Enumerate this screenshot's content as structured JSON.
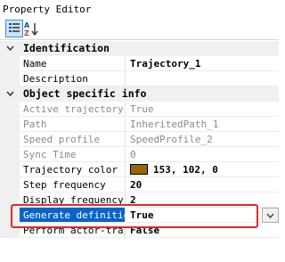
{
  "window": {
    "title": "Property Editor"
  },
  "toolbar": {
    "categorized": {
      "icon": "categorized-view-icon"
    },
    "alphabetical": {
      "icon": "sort-az-icon"
    }
  },
  "sections": [
    {
      "label": "Identification",
      "rows": [
        {
          "name": "Name",
          "value": "Trajectory_1"
        },
        {
          "name": "Description",
          "value": ""
        }
      ]
    },
    {
      "label": "Object specific info",
      "rows": [
        {
          "name": "Active trajectory",
          "value": "True"
        },
        {
          "name": "Path",
          "value": "InheritedPath_1"
        },
        {
          "name": "Speed profile",
          "value": "SpeedProfile_2"
        },
        {
          "name": "Sync Time",
          "value": "0"
        },
        {
          "name": "Trajectory color",
          "value": "153, 102, 0",
          "swatch": "#996600"
        },
        {
          "name": "Step frequency",
          "value": "20"
        },
        {
          "name": "Display frequency",
          "value": "2"
        },
        {
          "name": "Generate definition",
          "value": "True"
        },
        {
          "name": "Perform actor-trajectory",
          "value": "False"
        }
      ]
    }
  ],
  "colors": {
    "selection": "#0a64c8",
    "highlight_box": "#e0292b",
    "readonly_text": "#8a8a8a"
  }
}
